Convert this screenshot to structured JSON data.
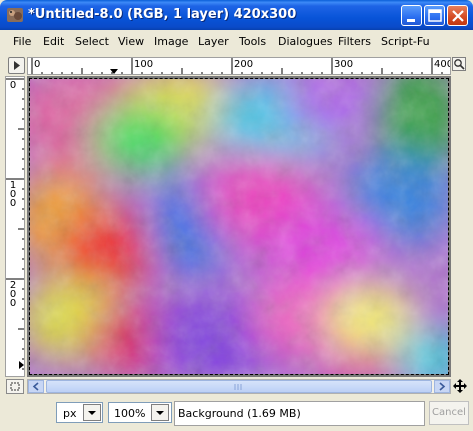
{
  "window": {
    "title": "*Untitled-8.0 (RGB, 1 layer) 420x300",
    "controls": {
      "minimize": "minimize-icon",
      "maximize": "maximize-icon",
      "close": "close-icon"
    }
  },
  "menu": [
    "File",
    "Edit",
    "Select",
    "View",
    "Image",
    "Layer",
    "Tools",
    "Dialogues",
    "Filters",
    "Script-Fu"
  ],
  "rulers": {
    "horizontal": [
      "0",
      "100",
      "200",
      "300",
      "400"
    ],
    "vertical": [
      "0",
      "100",
      "200"
    ]
  },
  "statusbar": {
    "unit": "px",
    "zoom": "100%",
    "layer_info": "Background (1.69 MB)",
    "cancel_label": "Cancel"
  },
  "colors": {
    "title_bar": "#0854d8",
    "close_button": "#d44a22",
    "scroll_thumb": "#bcd0f6"
  }
}
